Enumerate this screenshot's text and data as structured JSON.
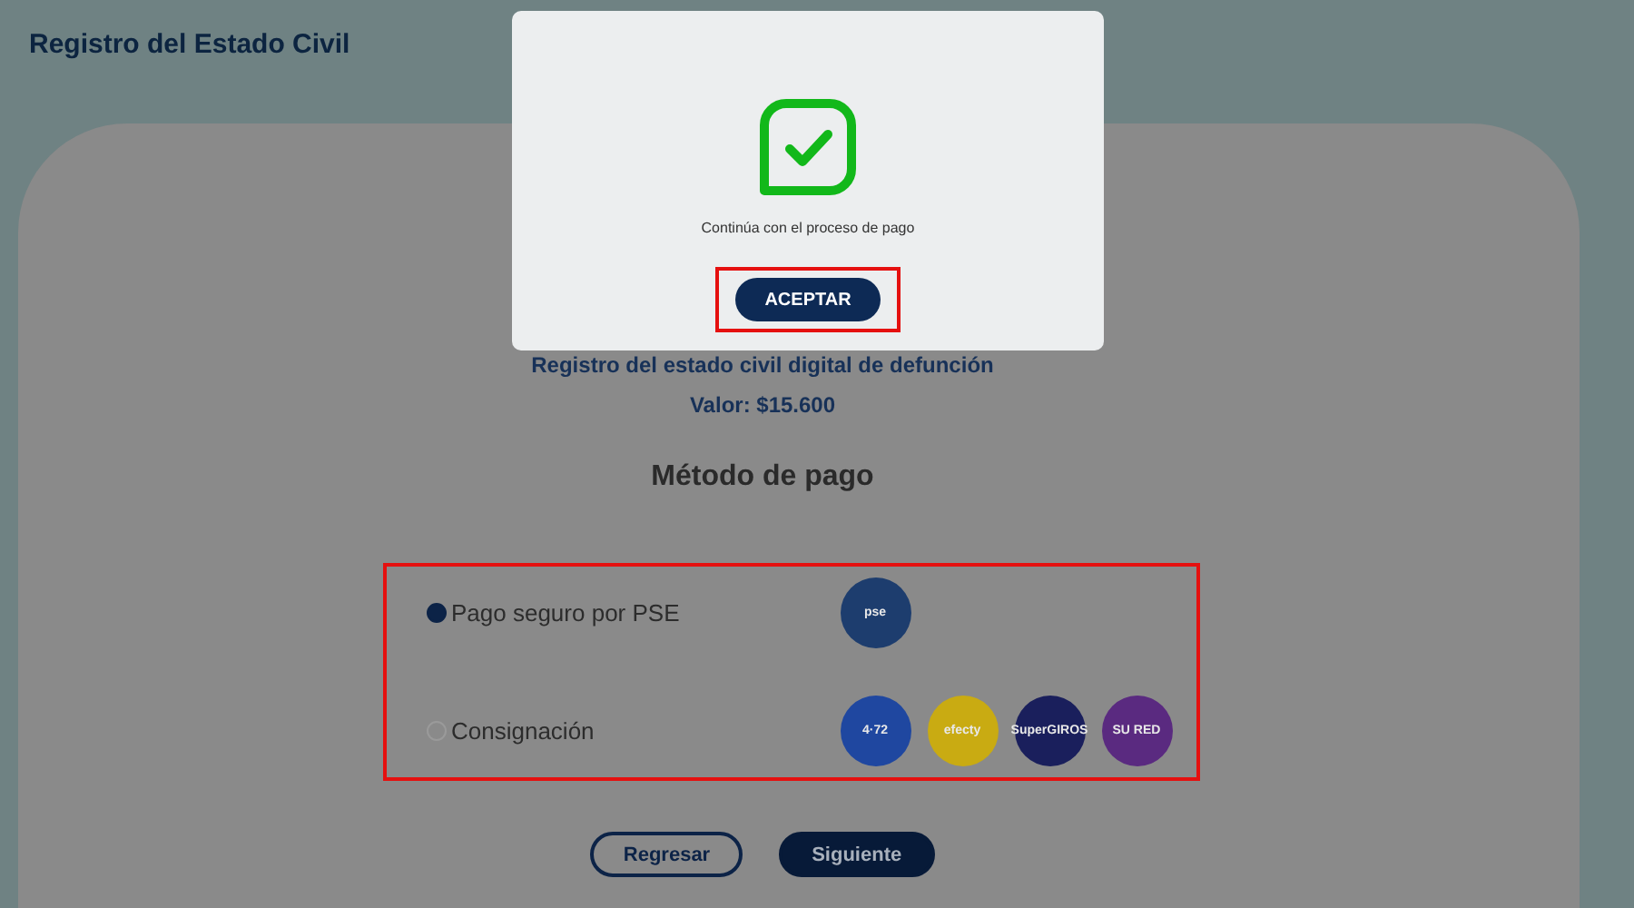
{
  "header": {
    "title": "Registro del Estado Civil"
  },
  "summary": {
    "service": "Registro del estado civil digital de defunción",
    "price": "Valor: $15.600"
  },
  "payment": {
    "title": "Método de pago",
    "methods": [
      {
        "label": "Pago seguro por PSE",
        "selected": true,
        "logos": [
          {
            "text": "pse",
            "color": "#1d3d6e"
          }
        ]
      },
      {
        "label": "Consignación",
        "selected": false,
        "logos": [
          {
            "text": "4·72",
            "color": "#1f47a0"
          },
          {
            "text": "efecty",
            "color": "#c9ab12"
          },
          {
            "text": "SuperGIROS",
            "color": "#1a1f5c"
          },
          {
            "text": "SU RED",
            "color": "#5a2a80"
          }
        ]
      }
    ]
  },
  "buttons": [
    {
      "label": "Regresar",
      "kind": "outline"
    },
    {
      "label": "Siguiente",
      "kind": "filled"
    }
  ],
  "modal": {
    "message": "Continúa con el proceso de pago",
    "button": "ACEPTAR"
  }
}
